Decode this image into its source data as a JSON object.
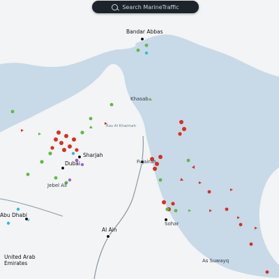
{
  "search": {
    "label": "Search MarineTraffic"
  },
  "places": {
    "bandar_abbas": "Bandar Abbas",
    "dubai": "Dubai",
    "sharjah": "Sharjah",
    "khasab": "Khasab",
    "fujairah": "Fujairah",
    "ras_al_khaimah": "Ras Al Khaimah",
    "abu_dhabi": "Abu Dhabi",
    "al_ain": "Al Ain",
    "sohar": "Sohar",
    "uae": "United Arab Emirates",
    "suwaiq": "As Suwayq",
    "jebel_ali": "Jebel Ali"
  }
}
